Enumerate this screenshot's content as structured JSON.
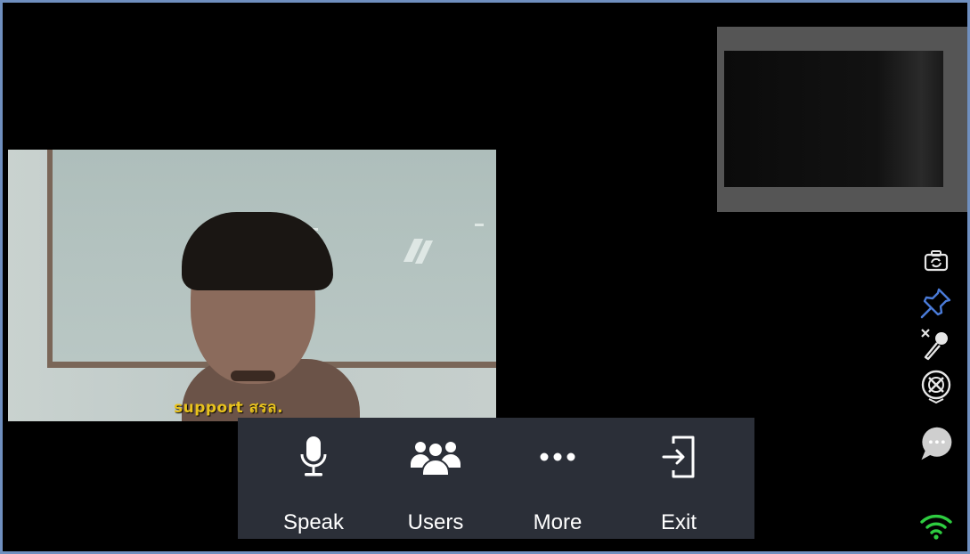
{
  "participant": {
    "name_label": "support สรล."
  },
  "toolbar": {
    "buttons": [
      {
        "label": "Speak",
        "icon": "microphone-icon"
      },
      {
        "label": "Users",
        "icon": "users-icon"
      },
      {
        "label": "More",
        "icon": "more-dots-icon"
      },
      {
        "label": "Exit",
        "icon": "exit-icon"
      }
    ]
  },
  "side_controls": [
    {
      "icon": "switch-camera-icon"
    },
    {
      "icon": "pin-icon",
      "color": "#4a7bd8"
    },
    {
      "icon": "mic-muted-icon"
    },
    {
      "icon": "video-off-icon"
    },
    {
      "icon": "chat-icon"
    },
    {
      "icon": "wifi-signal-icon",
      "color": "#2ecc40"
    }
  ],
  "colors": {
    "frame_border": "#6f8fbf",
    "toolbar_bg": "#2b2f38",
    "name_label": "#e8c21e"
  }
}
